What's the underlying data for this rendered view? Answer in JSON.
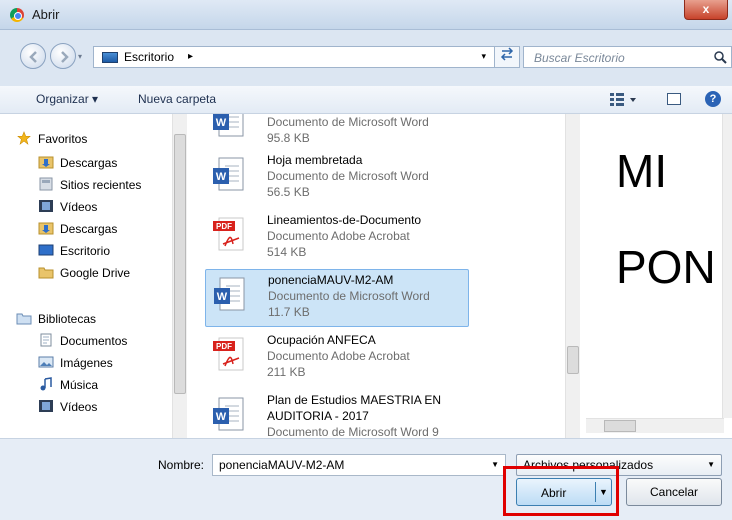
{
  "window": {
    "title": "Abrir",
    "close_label": "x"
  },
  "address": {
    "location": "Escritorio",
    "separator": "▸",
    "dropdown": "▾",
    "search_placeholder": "Buscar Escritorio"
  },
  "toolbar": {
    "organize_label": "Organizar ▾",
    "new_folder_label": "Nueva carpeta",
    "help_label": "?"
  },
  "sidebar": {
    "favorites_header": "Favoritos",
    "favorites": [
      {
        "label": "Descargas",
        "icon": "downloads-folder-icon"
      },
      {
        "label": "Sitios recientes",
        "icon": "recent-places-icon"
      },
      {
        "label": "Vídeos",
        "icon": "videos-icon"
      },
      {
        "label": "Descargas",
        "icon": "downloads-folder-icon"
      },
      {
        "label": "Escritorio",
        "icon": "desktop-icon"
      },
      {
        "label": "Google Drive",
        "icon": "folder-icon"
      }
    ],
    "libraries_header": "Bibliotecas",
    "libraries": [
      {
        "label": "Documentos",
        "icon": "documents-icon"
      },
      {
        "label": "Imágenes",
        "icon": "pictures-icon"
      },
      {
        "label": "Música",
        "icon": "music-icon"
      },
      {
        "label": "Vídeos",
        "icon": "videos-icon"
      }
    ]
  },
  "files": [
    {
      "name": "",
      "type": "Documento de Microsoft Word",
      "size": "95.8 KB",
      "icon": "word",
      "selected": false
    },
    {
      "name": "Hoja membretada",
      "type": "Documento de Microsoft Word",
      "size": "56.5 KB",
      "icon": "word",
      "selected": false
    },
    {
      "name": "Lineamientos-de-Documento",
      "type": "Documento Adobe Acrobat",
      "size": "514 KB",
      "icon": "pdf",
      "selected": false
    },
    {
      "name": "ponenciaMAUV-M2-AM",
      "type": "Documento de Microsoft Word",
      "size": "11.7 KB",
      "icon": "word",
      "selected": true
    },
    {
      "name": "Ocupación ANFECA",
      "type": "Documento Adobe Acrobat",
      "size": "211 KB",
      "icon": "pdf",
      "selected": false
    },
    {
      "name": "Plan de Estudios MAESTRIA EN",
      "name2": "AUDITORIA - 2017",
      "type": "Documento de Microsoft Word 9",
      "size": "",
      "icon": "word",
      "selected": false
    }
  ],
  "preview": {
    "line1": "MI",
    "line2": "PON"
  },
  "bottom": {
    "name_label": "Nombre:",
    "name_value": "ponenciaMAUV-M2-AM",
    "filter_value": "Archivos personalizados",
    "open_label": "Abrir",
    "cancel_label": "Cancelar",
    "dropdown_glyph": "▼"
  },
  "colors": {
    "accent": "#3c7fb1",
    "highlight": "#e00000",
    "selected": "#cce4f7"
  }
}
